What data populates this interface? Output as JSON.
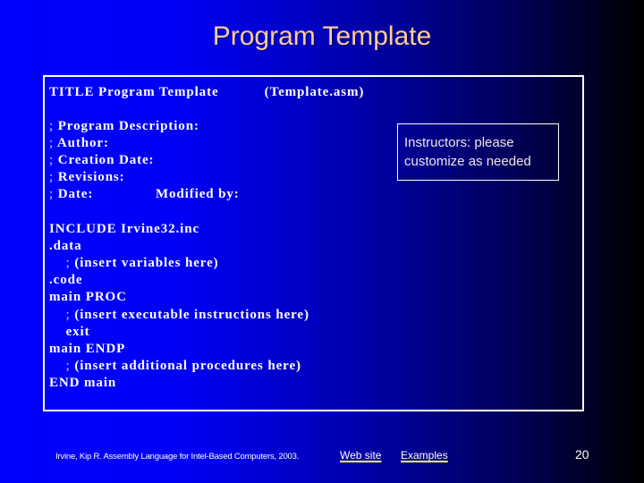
{
  "slide": {
    "title": "Program Template",
    "code_lines": [
      {
        "semi": "",
        "text": "TITLE Program Template           (Template.asm)"
      },
      {
        "semi": ";",
        "text": " Program Description:"
      },
      {
        "semi": ";",
        "text": " Author:"
      },
      {
        "semi": ";",
        "text": " Creation Date:"
      },
      {
        "semi": ";",
        "text": " Revisions:"
      },
      {
        "semi": ";",
        "text": " Date:               Modified by:"
      },
      {
        "semi": "",
        "text": "INCLUDE Irvine32.inc"
      },
      {
        "semi": "",
        "text": ".data"
      },
      {
        "semi": "    ;",
        "text": " (insert variables here)"
      },
      {
        "semi": "",
        "text": ".code"
      },
      {
        "semi": "",
        "text": "main PROC"
      },
      {
        "semi": "    ;",
        "text": " (insert executable instructions here)"
      },
      {
        "semi": "",
        "text": "    exit"
      },
      {
        "semi": "",
        "text": "main ENDP"
      },
      {
        "semi": "    ;",
        "text": " (insert additional procedures here)"
      },
      {
        "semi": "",
        "text": "END main"
      }
    ],
    "note": {
      "line1": "Instructors: please",
      "line2": "customize as needed"
    }
  },
  "footer": {
    "citation": "Irvine, Kip R. Assembly Language for Intel-Based Computers, 2003.",
    "links": [
      {
        "label": "Web site"
      },
      {
        "label": "Examples"
      }
    ],
    "page_number": "20"
  },
  "colors": {
    "title": "#ffcc99",
    "background_left": "#0000ff",
    "background_right": "#000000",
    "link_underline": "#ffff66"
  }
}
